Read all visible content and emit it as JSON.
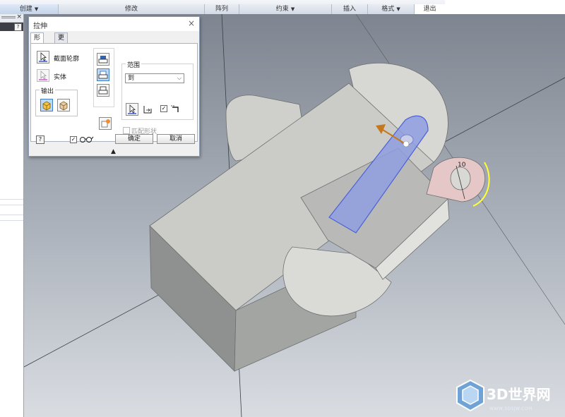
{
  "ribbon": {
    "groups": [
      {
        "label": "创建",
        "has_caret": true
      },
      {
        "label": "修改",
        "has_caret": false
      },
      {
        "label": "阵列",
        "has_caret": false
      },
      {
        "label": "约束",
        "has_caret": true
      },
      {
        "label": "插入",
        "has_caret": false
      },
      {
        "label": "格式",
        "has_caret": true
      },
      {
        "label": "退出",
        "has_caret": false
      }
    ]
  },
  "browser": {
    "help_label": "?"
  },
  "dialog": {
    "title": "拉伸",
    "close_glyph": "×",
    "tabs": [
      {
        "label": "形状",
        "active": true
      },
      {
        "label": "更多",
        "active": false
      }
    ],
    "profile_label": "截面轮廓",
    "solid_label": "实体",
    "output_label": "输出",
    "extents_label": "范围",
    "extents_value": "到",
    "match_shape_label": "匹配形状",
    "help_label": "?",
    "ok_label": "确定",
    "cancel_label": "取消",
    "expand_glyph": "▲"
  },
  "viewport": {
    "dimension_value": "10"
  },
  "watermark": {
    "brand": "3D世界网",
    "url": "WWW.3DSJW.COM"
  },
  "colors": {
    "accent_selected": "#bcd8f2",
    "preview_face": "#8f9ee0",
    "arrow": "#c6781e",
    "model_face": "#cfd0cc"
  }
}
